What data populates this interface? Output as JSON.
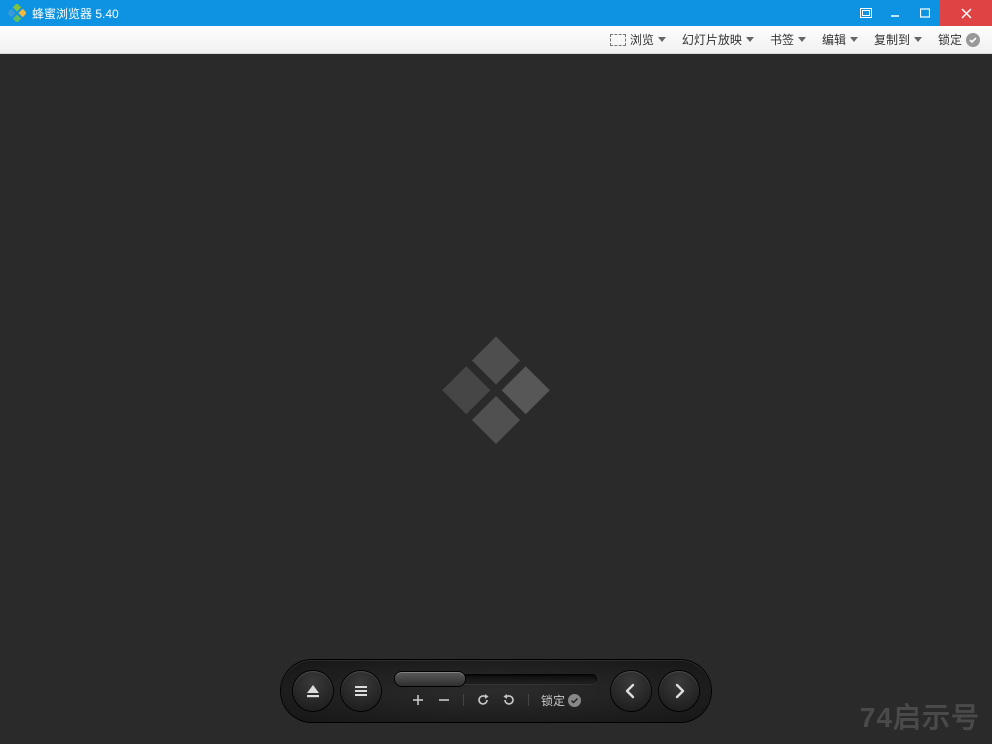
{
  "titlebar": {
    "title": "蜂蜜浏览器 5.40"
  },
  "toolbar": {
    "browse": "浏览",
    "slideshow": "幻灯片放映",
    "bookmark": "书签",
    "edit": "编辑",
    "copyto": "复制到",
    "lock": "锁定"
  },
  "controlbar": {
    "lock": "锁定"
  },
  "watermark": "74启示号"
}
